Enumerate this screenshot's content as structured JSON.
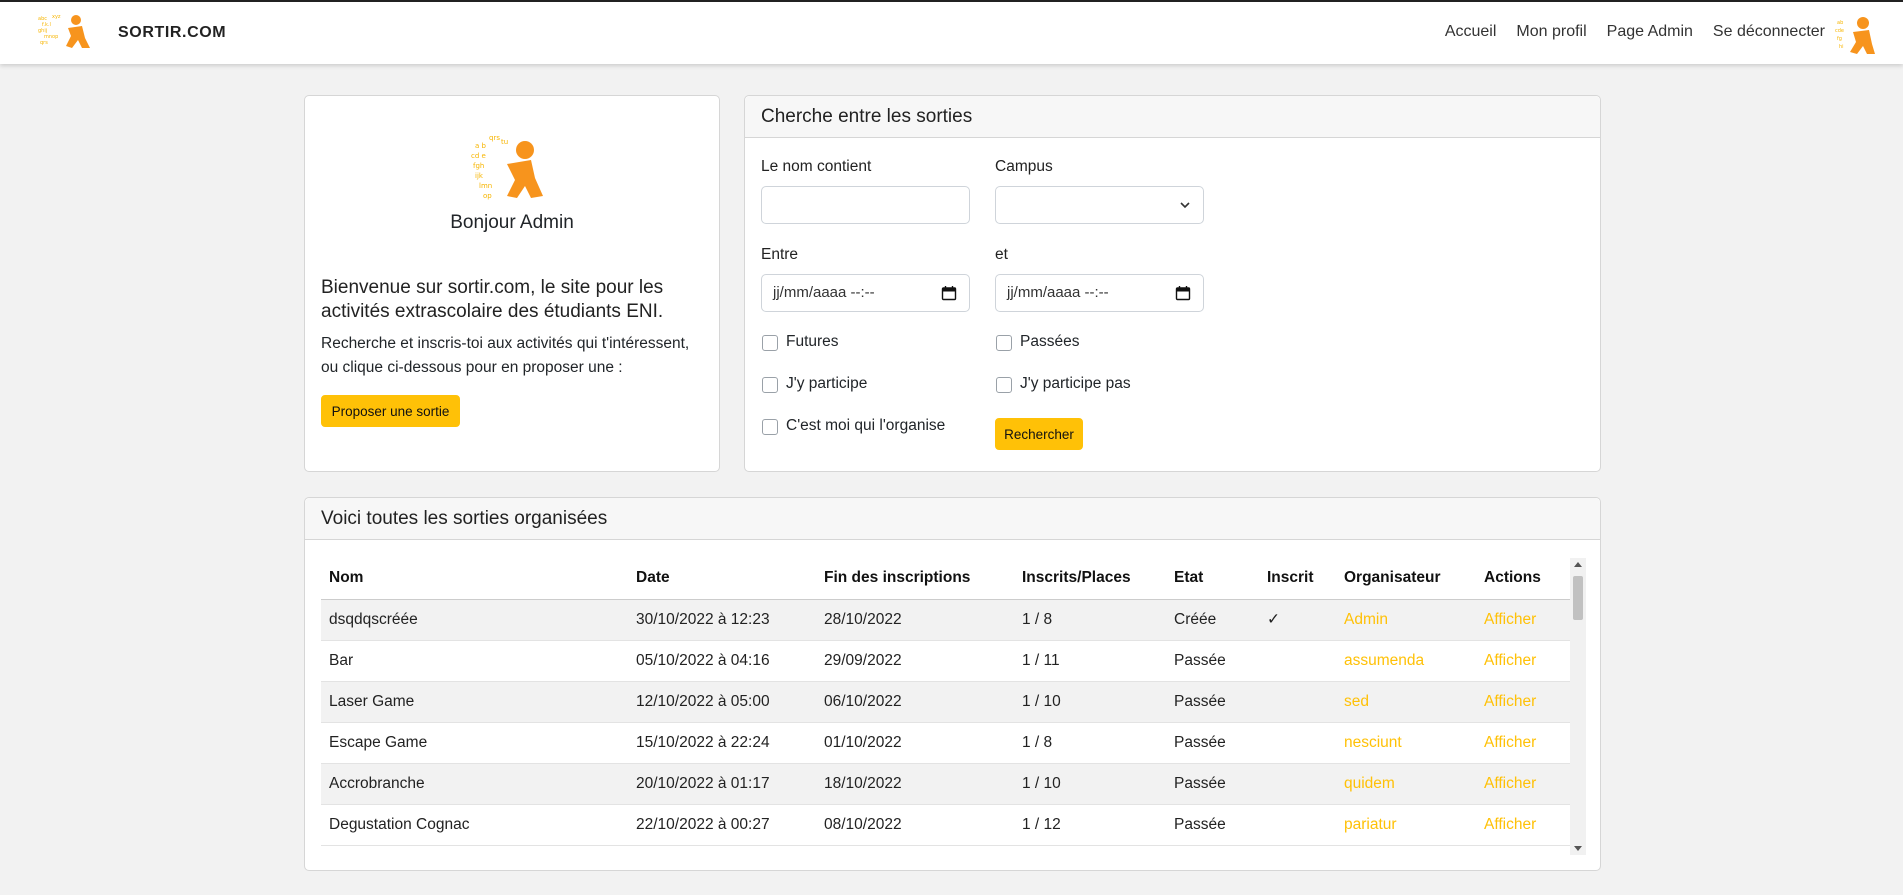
{
  "navbar": {
    "brand": "SORTIR.COM",
    "links": [
      "Accueil",
      "Mon profil",
      "Page Admin",
      "Se déconnecter"
    ]
  },
  "welcome": {
    "hello": "Bonjour Admin",
    "title": "Bienvenue sur sortir.com, le site pour les activités extrascolaire des étudiants ENI.",
    "text": "Recherche et inscris-toi aux activités qui t'intéressent, ou clique ci-dessous pour en proposer une :",
    "button": "Proposer une sortie"
  },
  "search": {
    "header": "Cherche entre les sorties",
    "name_label": "Le nom contient",
    "name_value": "",
    "campus_label": "Campus",
    "campus_value": "",
    "from_label": "Entre",
    "from_placeholder": "jj/mm/aaaa --:--",
    "to_label": "et",
    "to_placeholder": "jj/mm/aaaa --:--",
    "checks": {
      "futures": "Futures",
      "passees": "Passées",
      "participe": "J'y participe",
      "participe_pas": "J'y participe pas",
      "organise": "C'est moi qui l'organise"
    },
    "button": "Rechercher"
  },
  "table": {
    "header": "Voici toutes les sorties organisées",
    "columns": [
      "Nom",
      "Date",
      "Fin des inscriptions",
      "Inscrits/Places",
      "Etat",
      "Inscrit",
      "Organisateur",
      "Actions"
    ],
    "rows": [
      {
        "nom": "dsqdqscréée",
        "date": "30/10/2022 à 12:23",
        "fin": "28/10/2022",
        "places": "1 / 8",
        "etat": "Créée",
        "inscrit": "✓",
        "org": "Admin",
        "action": "Afficher"
      },
      {
        "nom": "Bar",
        "date": "05/10/2022 à 04:16",
        "fin": "29/09/2022",
        "places": "1 / 11",
        "etat": "Passée",
        "inscrit": "",
        "org": "assumenda",
        "action": "Afficher"
      },
      {
        "nom": "Laser Game",
        "date": "12/10/2022 à 05:00",
        "fin": "06/10/2022",
        "places": "1 / 10",
        "etat": "Passée",
        "inscrit": "",
        "org": "sed",
        "action": "Afficher"
      },
      {
        "nom": "Escape Game",
        "date": "15/10/2022 à 22:24",
        "fin": "01/10/2022",
        "places": "1 / 8",
        "etat": "Passée",
        "inscrit": "",
        "org": "nesciunt",
        "action": "Afficher"
      },
      {
        "nom": "Accrobranche",
        "date": "20/10/2022 à 01:17",
        "fin": "18/10/2022",
        "places": "1 / 10",
        "etat": "Passée",
        "inscrit": "",
        "org": "quidem",
        "action": "Afficher"
      },
      {
        "nom": "Degustation Cognac",
        "date": "22/10/2022 à 00:27",
        "fin": "08/10/2022",
        "places": "1 / 12",
        "etat": "Passée",
        "inscrit": "",
        "org": "pariatur",
        "action": "Afficher"
      }
    ]
  },
  "colors": {
    "accent": "#ffc107",
    "logo_orange": "#f7941d"
  }
}
